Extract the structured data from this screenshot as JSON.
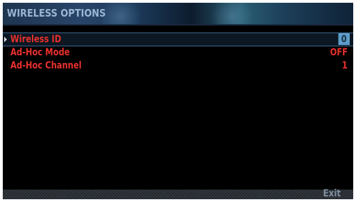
{
  "header": {
    "title": "WIRELESS OPTIONS"
  },
  "settings": {
    "items": [
      {
        "label": "Wireless ID",
        "value": "0",
        "selected": true
      },
      {
        "label": "Ad-Hoc Mode",
        "value": "OFF",
        "selected": false
      },
      {
        "label": "Ad-Hoc Channel",
        "value": "1",
        "selected": false
      }
    ]
  },
  "footer": {
    "exit_label": "Exit"
  },
  "colors": {
    "label_red": "#e8302d",
    "highlight_blue": "#5d9dc9",
    "title_text": "#9ab6d4",
    "background": "#000000"
  },
  "icons": {
    "cursor": "triangle-right-icon"
  }
}
